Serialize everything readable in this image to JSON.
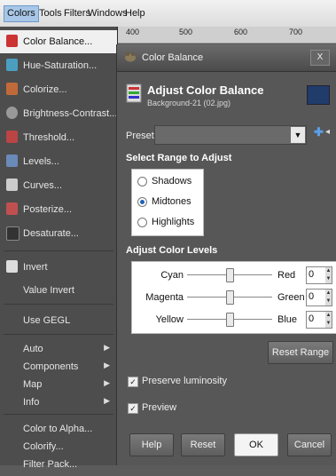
{
  "menubar": {
    "items": [
      {
        "label": "Colors",
        "active": true
      },
      {
        "label": "Tools"
      },
      {
        "label": "Filters"
      },
      {
        "label": "Windows"
      },
      {
        "label": "Help"
      }
    ]
  },
  "ruler": {
    "labels": [
      "400",
      "500",
      "600",
      "700"
    ]
  },
  "colors_menu": {
    "items": [
      {
        "label": "Color Balance...",
        "icon": "color-balance-icon",
        "color": "#cc3333",
        "highlight": true
      },
      {
        "label": "Hue-Saturation...",
        "icon": "hue-saturation-icon",
        "color": "#4a9fc0"
      },
      {
        "label": "Colorize...",
        "icon": "colorize-icon",
        "color": "#c06a3a"
      },
      {
        "label": "Brightness-Contrast...",
        "icon": "brightness-contrast-icon",
        "color": "#999999"
      },
      {
        "label": "Threshold...",
        "icon": "threshold-icon",
        "color": "#bb4444"
      },
      {
        "label": "Levels...",
        "icon": "levels-icon",
        "color": "#6a8ab8"
      },
      {
        "label": "Curves...",
        "icon": "curves-icon",
        "color": "#cccccc"
      },
      {
        "label": "Posterize...",
        "icon": "posterize-icon",
        "color": "#c05050"
      },
      {
        "label": "Desaturate...",
        "icon": "desaturate-icon",
        "color": "#333333"
      },
      {
        "label": "Invert",
        "icon": "invert-icon",
        "color": "#dddddd"
      },
      {
        "label": "Value Invert"
      },
      {
        "label": "Use GEGL"
      },
      {
        "label": "Auto",
        "submenu": true
      },
      {
        "label": "Components",
        "submenu": true
      },
      {
        "label": "Map",
        "submenu": true
      },
      {
        "label": "Info",
        "submenu": true
      },
      {
        "label": "Color to Alpha..."
      },
      {
        "label": "Colorify..."
      },
      {
        "label": "Filter Pack..."
      }
    ]
  },
  "dialog": {
    "title": "Color Balance",
    "close_label": "X",
    "header_title": "Adjust Color Balance",
    "header_subtitle": "Background-21 (02.jpg)",
    "presets_label": "Presets:",
    "presets_value": "",
    "range_title": "Select Range to Adjust",
    "ranges": [
      {
        "label": "Shadows",
        "checked": false
      },
      {
        "label": "Midtones",
        "checked": true
      },
      {
        "label": "Highlights",
        "checked": false
      }
    ],
    "levels_title": "Adjust Color Levels",
    "levels": [
      {
        "left": "Cyan",
        "right": "Red",
        "value": "0",
        "position": 0.5
      },
      {
        "left": "Magenta",
        "right": "Green",
        "value": "0",
        "position": 0.5
      },
      {
        "left": "Yellow",
        "right": "Blue",
        "value": "0",
        "position": 0.5
      }
    ],
    "reset_range_label": "Reset Range",
    "preserve_label": "Preserve luminosity",
    "preserve_checked": true,
    "preview_label": "Preview",
    "preview_checked": true,
    "buttons": {
      "help": "Help",
      "reset": "Reset",
      "ok": "OK",
      "cancel": "Cancel"
    }
  }
}
